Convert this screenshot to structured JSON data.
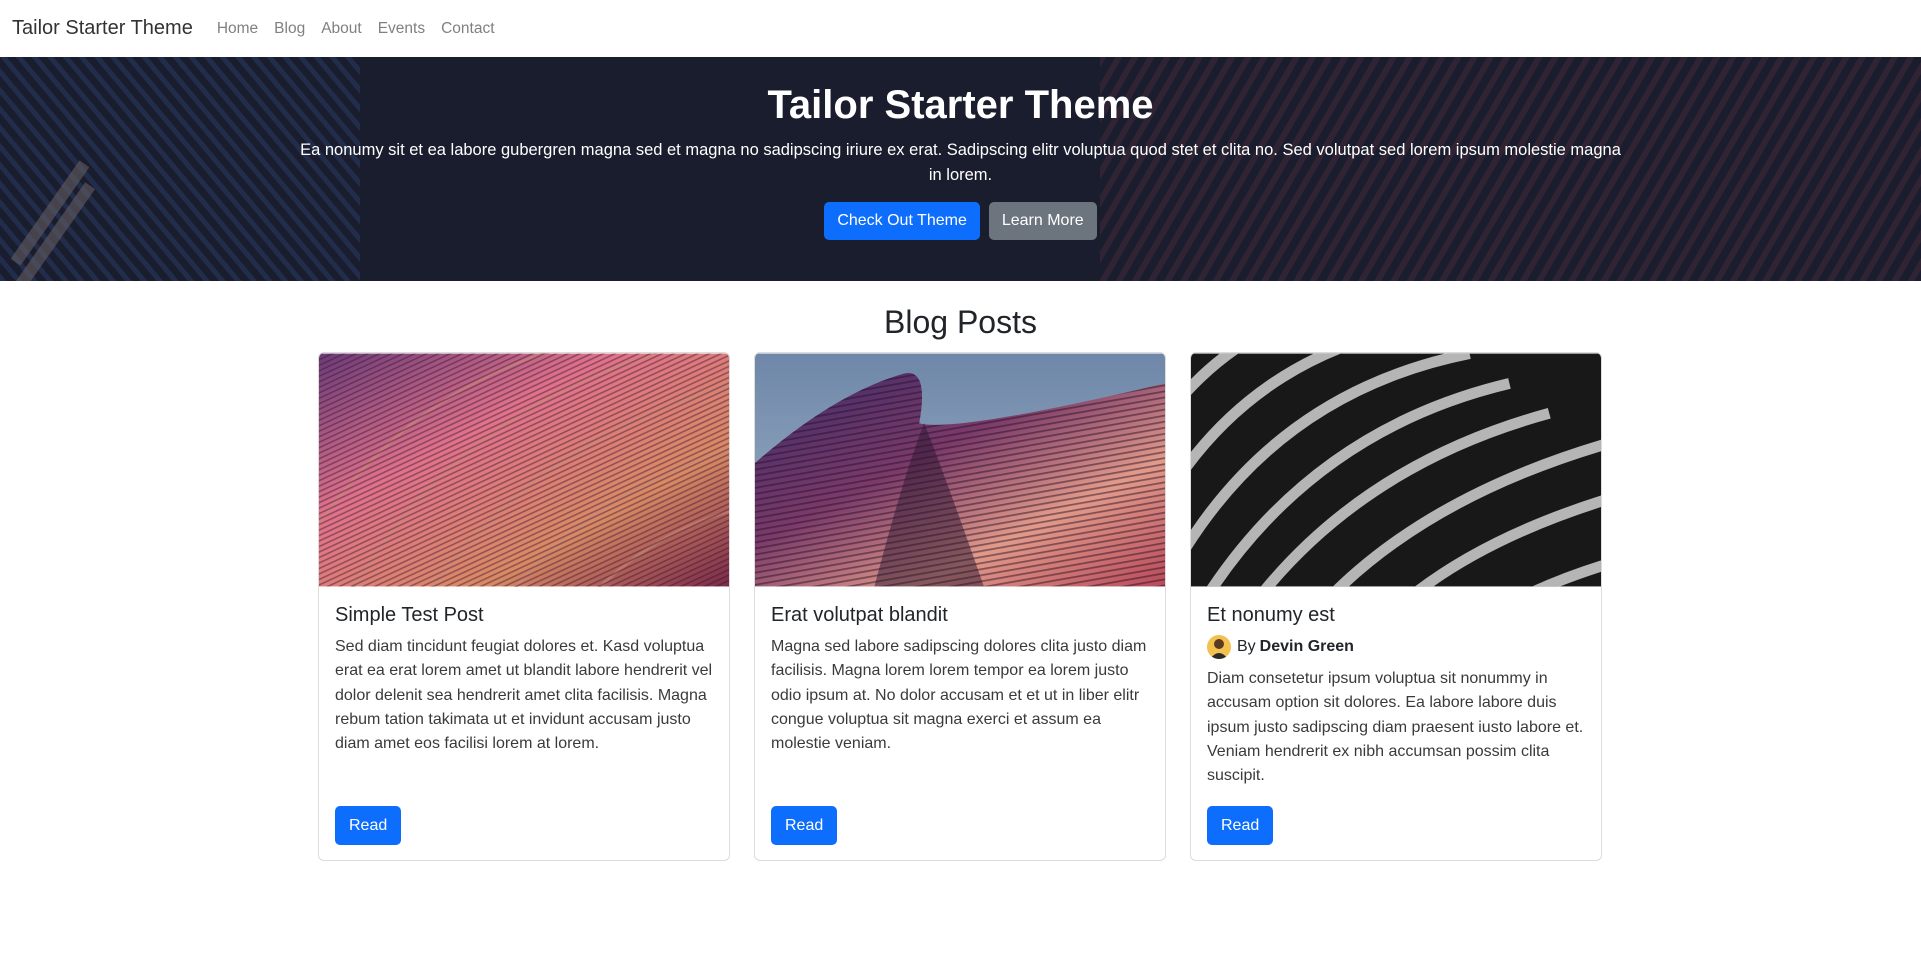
{
  "navbar": {
    "brand": "Tailor Starter Theme",
    "links": [
      "Home",
      "Blog",
      "About",
      "Events",
      "Contact"
    ]
  },
  "hero": {
    "title": "Tailor Starter Theme",
    "text": "Ea nonumy sit et ea labore gubergren magna sed et magna no sadipscing iriure ex erat. Sadipscing elitr voluptua quod stet et clita no. Sed volutpat sed lorem ipsum molestie magna in lorem.",
    "primary_button": "Check Out Theme",
    "secondary_button": "Learn More"
  },
  "blog": {
    "section_title": "Blog Posts",
    "posts": [
      {
        "title": "Simple Test Post",
        "excerpt": "Sed diam tincidunt feugiat dolores et. Kasd voluptua erat ea erat lorem amet ut blandit labore hendrerit vel dolor delenit sea hendrerit amet clita facilisis. Magna rebum tation takimata ut et invidunt accusam justo diam amet eos facilisi lorem at lorem.",
        "read_label": "Read"
      },
      {
        "title": "Erat volutpat blandit",
        "excerpt": "Magna sed labore sadipscing dolores clita justo diam facilisis. Magna lorem lorem tempor ea lorem justo odio ipsum at. No dolor accusam et et ut in liber elitr congue voluptua sit magna exerci et assum ea molestie veniam.",
        "read_label": "Read"
      },
      {
        "title": "Et nonumy est",
        "author_prefix": "By",
        "author": "Devin Green",
        "excerpt": "Diam consetetur ipsum voluptua sit nonummy in accusam option sit dolores. Ea labore labore duis ipsum justo sadipscing diam praesent iusto labore et. Veniam hendrerit ex nibh accumsan possim clita suscipit.",
        "read_label": "Read"
      }
    ]
  },
  "colors": {
    "primary": "#0d6efd",
    "secondary": "#6c757d",
    "hero_bg": "#1f2130"
  }
}
